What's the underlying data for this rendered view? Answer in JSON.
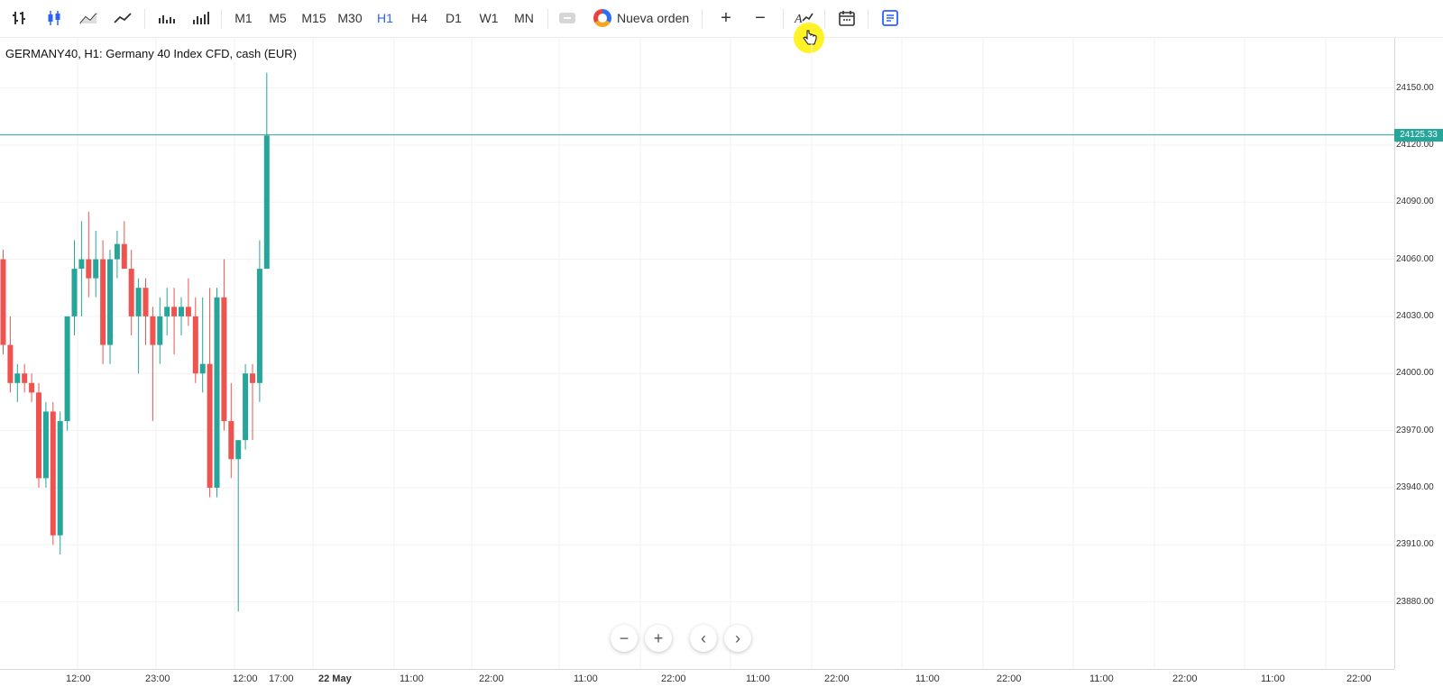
{
  "toolbar": {
    "chart_types": [
      {
        "name": "bar-chart-icon"
      },
      {
        "name": "candlestick-chart-icon"
      },
      {
        "name": "line-chart-icon"
      },
      {
        "name": "line-chart-alt-icon"
      },
      {
        "name": "volume-icon"
      },
      {
        "name": "tick-volume-icon"
      }
    ],
    "timeframes": [
      "M1",
      "M5",
      "M15",
      "M30",
      "H1",
      "H4",
      "D1",
      "W1",
      "MN"
    ],
    "active_timeframe": "H1",
    "new_order_label": "Nueva orden",
    "zoom_in_label": "+",
    "zoom_out_label": "−"
  },
  "chart": {
    "title": "GERMANY40, H1: Germany 40 Index CFD, cash (EUR)",
    "current_price": "24125.33",
    "price_ticks": [
      "24150.00",
      "24120.00",
      "24090.00",
      "24060.00",
      "24030.00",
      "24000.00",
      "23970.00",
      "23940.00",
      "23910.00",
      "23880.00"
    ],
    "time_ticks": [
      "12:00",
      "23:00",
      "12:00",
      "17:00",
      "22 May",
      "11:00",
      "22:00",
      "11:00",
      "22:00",
      "11:00",
      "22:00",
      "11:00",
      "22:00",
      "11:00",
      "22:00",
      "11:00",
      "22:00"
    ],
    "up_color": "#26a69a",
    "down_color": "#ef5350",
    "grid_color": "#f2f2f2"
  },
  "chart_data": {
    "type": "candlestick",
    "title": "GERMANY40, H1: Germany 40 Index CFD, cash (EUR)",
    "ylim": [
      23870,
      24165
    ],
    "candles": [
      {
        "o": 24060,
        "h": 24065,
        "l": 24010,
        "c": 24015
      },
      {
        "o": 24015,
        "h": 24030,
        "l": 23990,
        "c": 23995
      },
      {
        "o": 23995,
        "h": 24005,
        "l": 23985,
        "c": 24000
      },
      {
        "o": 24000,
        "h": 24005,
        "l": 23990,
        "c": 23995
      },
      {
        "o": 23995,
        "h": 24000,
        "l": 23985,
        "c": 23990
      },
      {
        "o": 23990,
        "h": 23995,
        "l": 23940,
        "c": 23945
      },
      {
        "o": 23945,
        "h": 23985,
        "l": 23940,
        "c": 23980
      },
      {
        "o": 23980,
        "h": 23985,
        "l": 23910,
        "c": 23915
      },
      {
        "o": 23915,
        "h": 23980,
        "l": 23905,
        "c": 23975
      },
      {
        "o": 23975,
        "h": 24010,
        "l": 23970,
        "c": 24030
      },
      {
        "o": 24030,
        "h": 24070,
        "l": 24020,
        "c": 24055
      },
      {
        "o": 24055,
        "h": 24080,
        "l": 24030,
        "c": 24060
      },
      {
        "o": 24060,
        "h": 24085,
        "l": 24040,
        "c": 24050
      },
      {
        "o": 24050,
        "h": 24075,
        "l": 24040,
        "c": 24060
      },
      {
        "o": 24060,
        "h": 24070,
        "l": 24005,
        "c": 24015
      },
      {
        "o": 24015,
        "h": 24065,
        "l": 24005,
        "c": 24060
      },
      {
        "o": 24060,
        "h": 24075,
        "l": 24050,
        "c": 24068
      },
      {
        "o": 24068,
        "h": 24080,
        "l": 24055,
        "c": 24055
      },
      {
        "o": 24055,
        "h": 24065,
        "l": 24020,
        "c": 24030
      },
      {
        "o": 24030,
        "h": 24050,
        "l": 24000,
        "c": 24045
      },
      {
        "o": 24045,
        "h": 24050,
        "l": 24015,
        "c": 24030
      },
      {
        "o": 24030,
        "h": 24035,
        "l": 23975,
        "c": 24015
      },
      {
        "o": 24015,
        "h": 24040,
        "l": 24005,
        "c": 24030
      },
      {
        "o": 24030,
        "h": 24045,
        "l": 24020,
        "c": 24035
      },
      {
        "o": 24035,
        "h": 24045,
        "l": 24010,
        "c": 24030
      },
      {
        "o": 24030,
        "h": 24040,
        "l": 24020,
        "c": 24035
      },
      {
        "o": 24035,
        "h": 24050,
        "l": 24025,
        "c": 24030
      },
      {
        "o": 24030,
        "h": 24040,
        "l": 23995,
        "c": 24000
      },
      {
        "o": 24000,
        "h": 24040,
        "l": 23990,
        "c": 24005
      },
      {
        "o": 24005,
        "h": 24045,
        "l": 23935,
        "c": 23940
      },
      {
        "o": 23940,
        "h": 24045,
        "l": 23935,
        "c": 24040
      },
      {
        "o": 24040,
        "h": 24060,
        "l": 23970,
        "c": 23975
      },
      {
        "o": 23975,
        "h": 23995,
        "l": 23945,
        "c": 23955
      },
      {
        "o": 23955,
        "h": 23965,
        "l": 23875,
        "c": 23965
      },
      {
        "o": 23965,
        "h": 24005,
        "l": 23960,
        "c": 24000
      },
      {
        "o": 24000,
        "h": 24005,
        "l": 23965,
        "c": 23995
      },
      {
        "o": 23995,
        "h": 24070,
        "l": 23985,
        "c": 24055
      },
      {
        "o": 24055,
        "h": 24158,
        "l": 24055,
        "c": 24125
      }
    ]
  }
}
